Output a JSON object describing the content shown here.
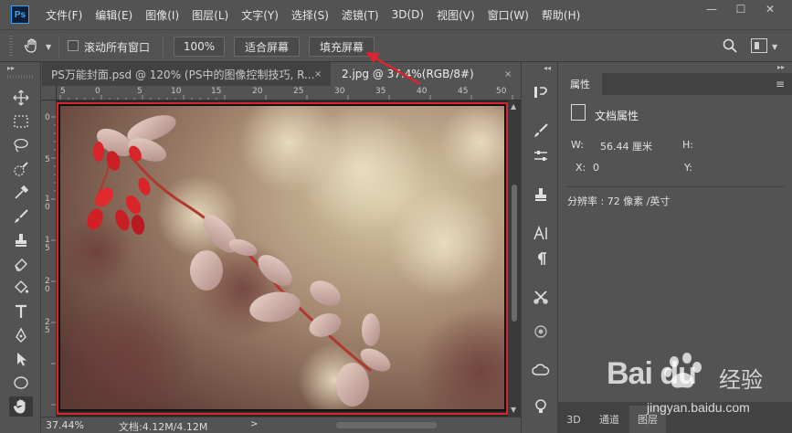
{
  "app": {
    "logo": "Ps",
    "menu": [
      "文件(F)",
      "编辑(E)",
      "图像(I)",
      "图层(L)",
      "文字(Y)",
      "选择(S)",
      "滤镜(T)",
      "3D(D)",
      "视图(V)",
      "窗口(W)",
      "帮助(H)"
    ],
    "window_controls": {
      "minimize": "—",
      "maximize": "☐",
      "close": "✕"
    }
  },
  "options": {
    "scroll_all_windows": "滚动所有窗口",
    "zoom_value": "100%",
    "fit_screen": "适合屏幕",
    "fill_screen": "填充屏幕"
  },
  "tabs": [
    {
      "label": "PS万能封面.psd @ 120% (PS中的图像控制技巧, R...",
      "close": "×"
    },
    {
      "label": "2.jpg @ 37.4%(RGB/8#)",
      "close": "×"
    }
  ],
  "rulers": {
    "top": [
      "5",
      "0",
      "5",
      "10",
      "15",
      "20",
      "25",
      "30",
      "35",
      "40",
      "45",
      "50"
    ],
    "left": [
      "0",
      "5",
      "1\n0",
      "1\n5",
      "2\n0",
      "2\n5"
    ]
  },
  "status": {
    "zoom": "37.44%",
    "doc": "文档:4.12M/4.12M"
  },
  "properties": {
    "tab": "属性",
    "section": "文档属性",
    "w_label": "W:",
    "w_value": "56.44 厘米",
    "h_label": "H:",
    "x_label": "X:",
    "x_value": "0",
    "y_label": "Y:",
    "resolution": "分辨率 : 72 像素 /英寸"
  },
  "bottom_tabs": [
    "3D",
    "通道",
    "图层"
  ],
  "watermark": {
    "brand": "Bai du",
    "suffix": "经验",
    "url": "jingyan.baidu.com"
  },
  "colors": {
    "accent_red": "#d7262c",
    "ps_blue": "#31a8ff",
    "panel_bg": "#535353"
  }
}
